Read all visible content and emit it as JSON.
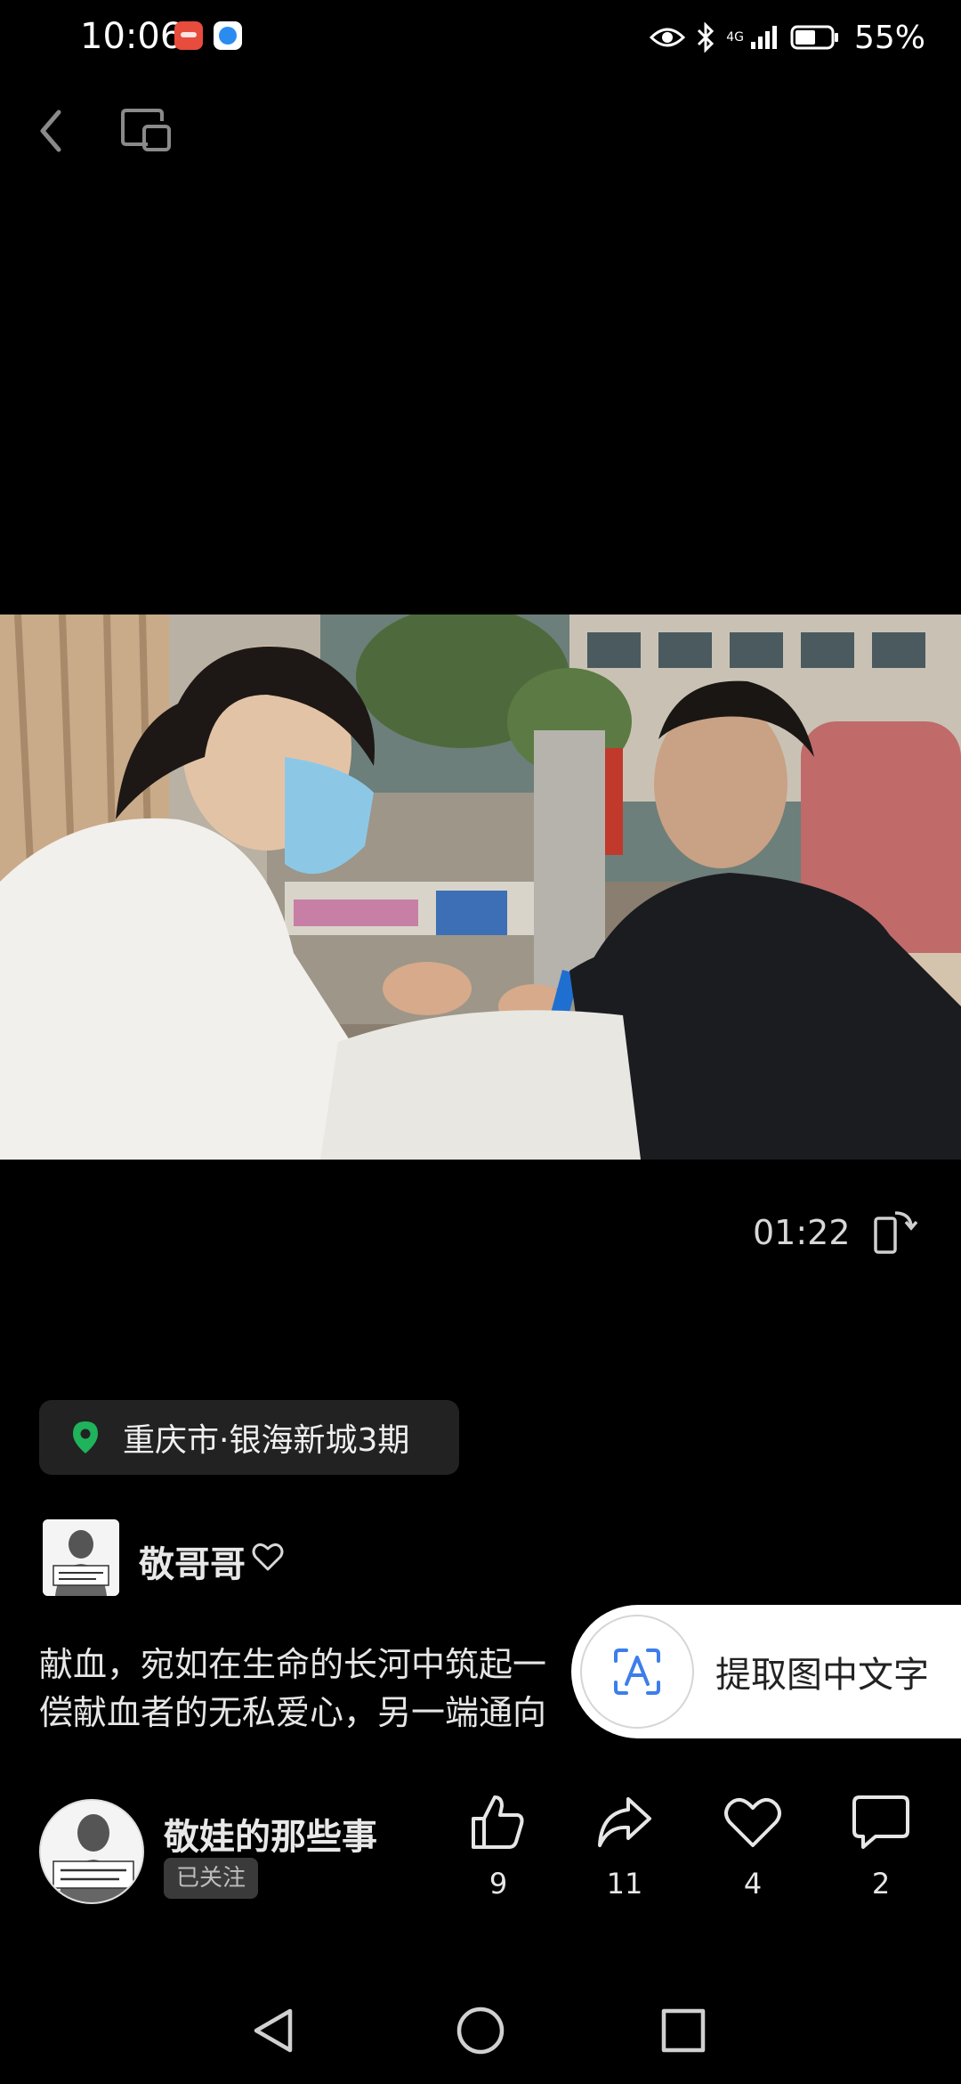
{
  "status_bar": {
    "time": "10:06",
    "network": "4G",
    "battery_percent": "55%"
  },
  "video": {
    "elapsed": "01:22"
  },
  "location": {
    "text": "重庆市·银海新城3期"
  },
  "author": {
    "name": "敬哥哥"
  },
  "caption": {
    "line1": "献血，宛如在生命的长河中筑起一",
    "line2": "偿献血者的无私爱心，另一端通向"
  },
  "ocr_button": {
    "label": "提取图中文字"
  },
  "footer": {
    "account_name": "敬娃的那些事",
    "follow_status": "已关注",
    "likes": "9",
    "shares": "11",
    "favorites": "4",
    "comments": "2"
  },
  "colors": {
    "background": "#000000",
    "location_pin": "#1fb35b",
    "chip_bg": "#222222",
    "ocr_accent": "#3d7eea"
  }
}
